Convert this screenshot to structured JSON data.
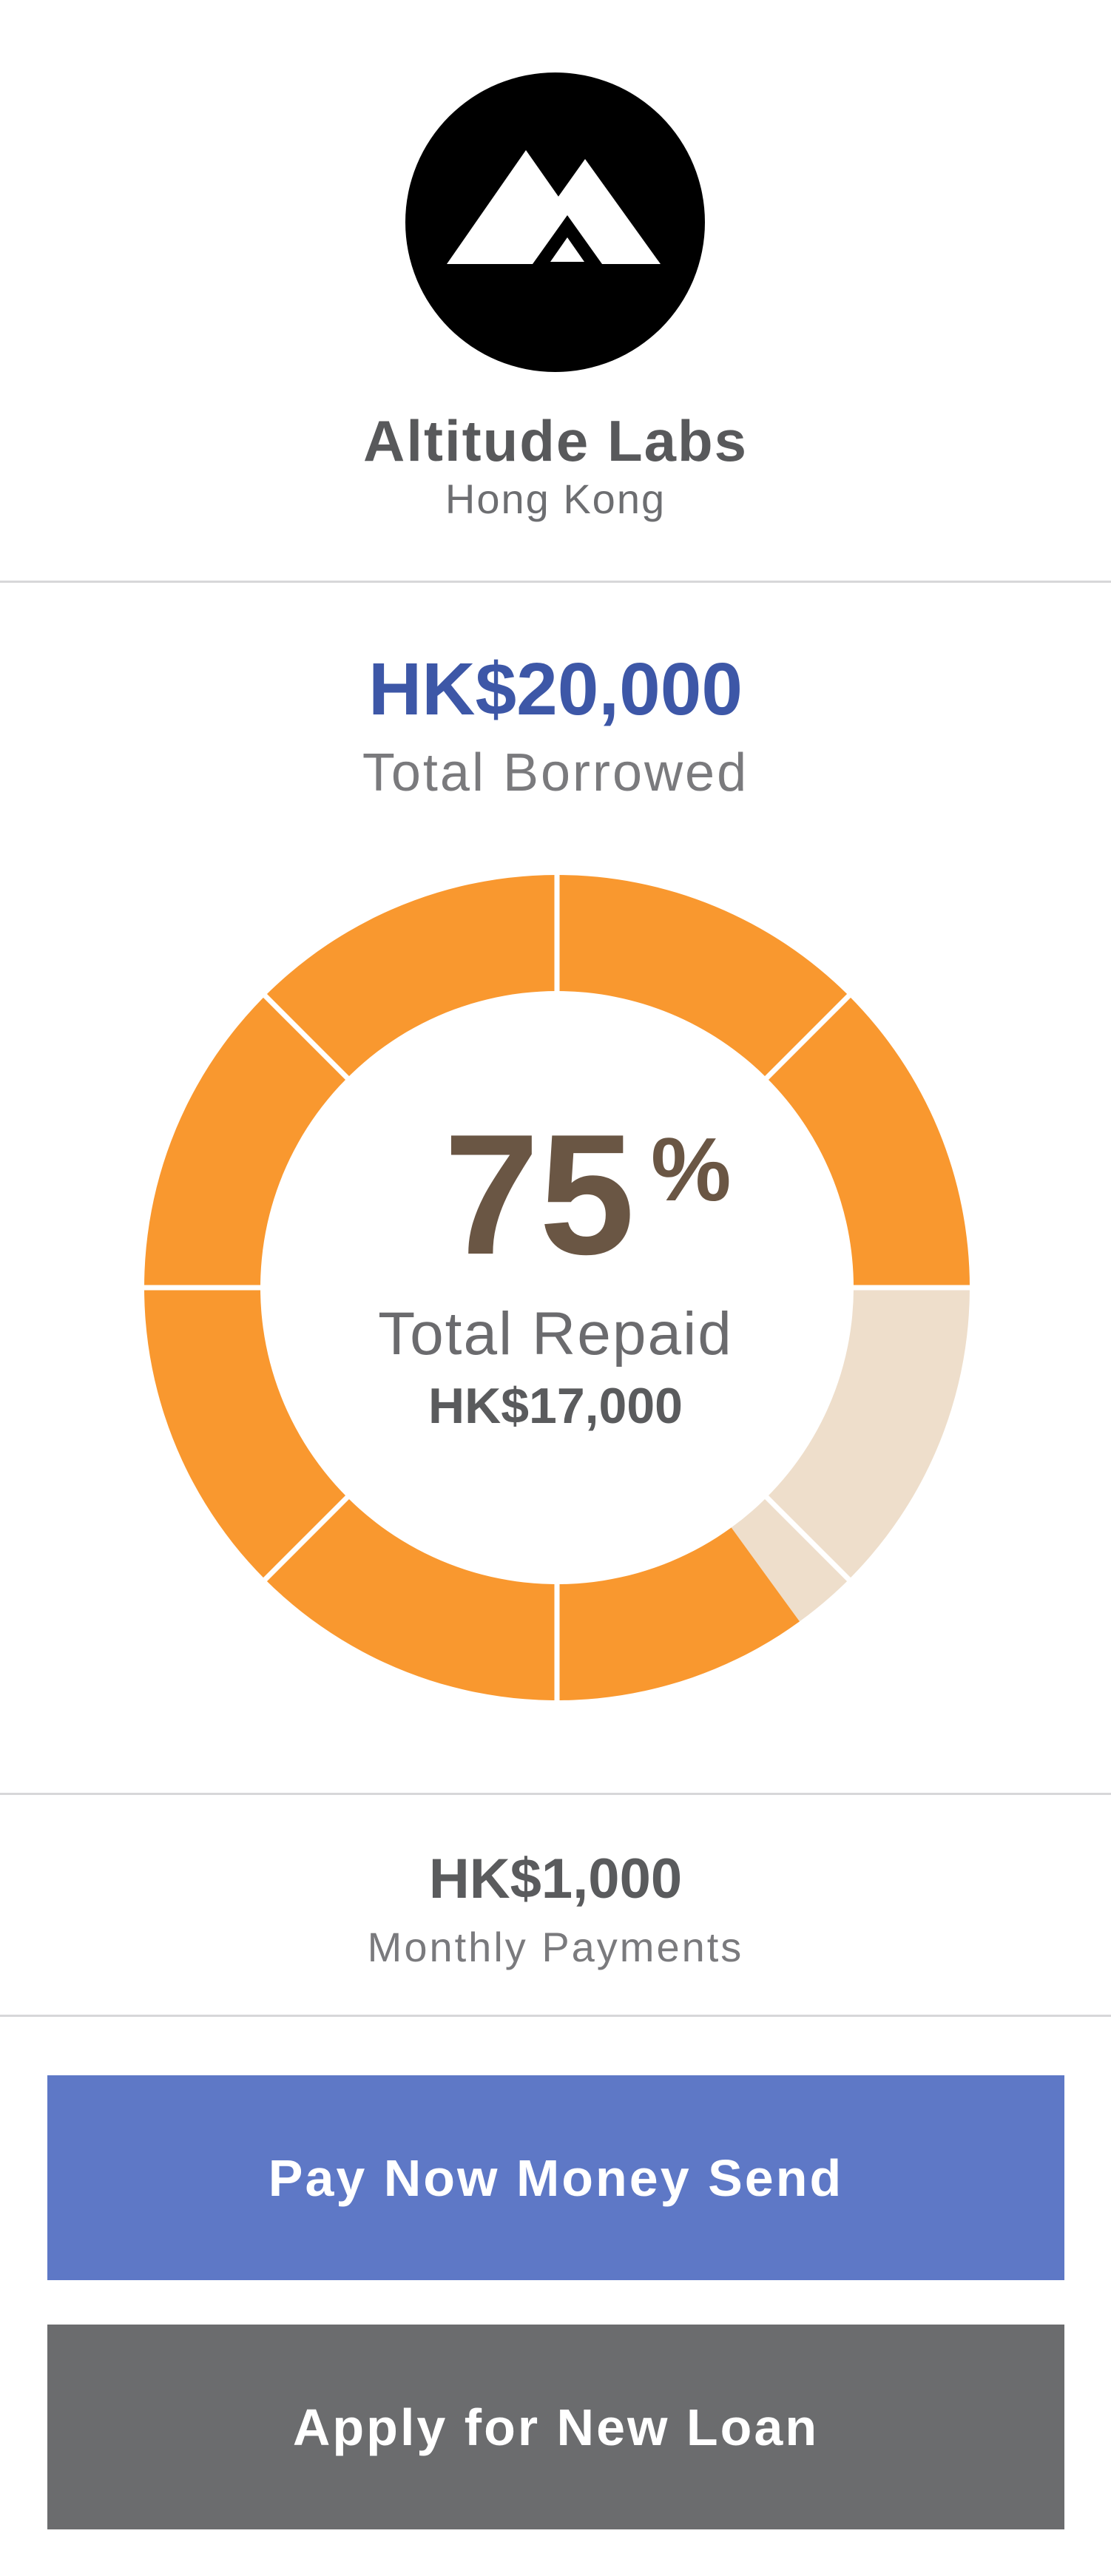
{
  "company": {
    "name": "Altitude Labs",
    "location": "Hong Kong",
    "logo_icon": "mountain-logo-icon"
  },
  "loan": {
    "total_borrowed_amount": "HK$20,000",
    "total_borrowed_label": "Total Borrowed",
    "repaid_percent_number": "75",
    "repaid_percent_sign": "%",
    "repaid_label": "Total Repaid",
    "repaid_amount": "HK$17,000",
    "monthly_amount": "HK$1,000",
    "monthly_label": "Monthly Payments"
  },
  "chart_data": {
    "type": "pie",
    "segments_total": 10,
    "repaid_fraction": 0.85,
    "colors": {
      "repaid": "#f9982f",
      "remaining": "#eedecb"
    }
  },
  "actions": {
    "pay_label": "Pay Now Money Send",
    "apply_label": "Apply for New Loan"
  },
  "colors": {
    "accent_blue": "#3d57a7",
    "pay_button": "#5e78c6",
    "apply_button": "#6b6c6e",
    "percent_text": "#6a5644"
  }
}
